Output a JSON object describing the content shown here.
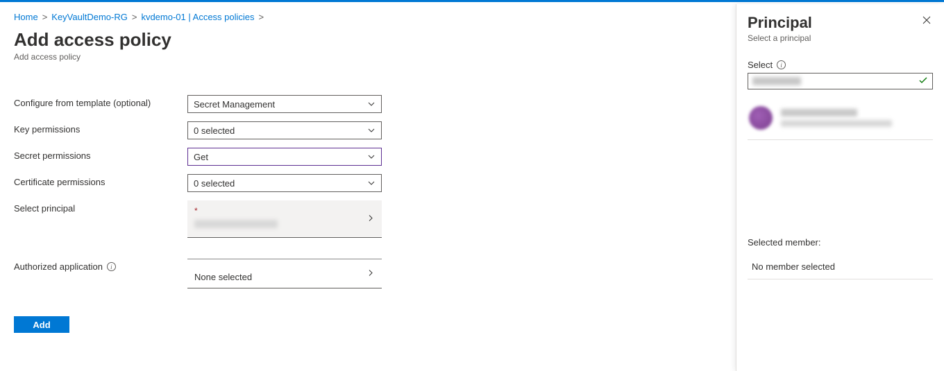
{
  "breadcrumb": {
    "home": "Home",
    "rg": "KeyVaultDemo-RG",
    "kv": "kvdemo-01 | Access policies"
  },
  "page": {
    "title": "Add access policy",
    "subtitle": "Add access policy"
  },
  "form": {
    "templateLabel": "Configure from template (optional)",
    "templateValue": "Secret Management",
    "keyPermLabel": "Key permissions",
    "keyPermValue": "0 selected",
    "secretPermLabel": "Secret permissions",
    "secretPermValue": "Get",
    "certPermLabel": "Certificate permissions",
    "certPermValue": "0 selected",
    "principalLabel": "Select principal",
    "appLabel": "Authorized application",
    "appValue": "None selected",
    "addBtn": "Add"
  },
  "flyout": {
    "title": "Principal",
    "subtitle": "Select a principal",
    "selectLabel": "Select",
    "selectedMemberLabel": "Selected member:",
    "noMember": "No member selected"
  }
}
